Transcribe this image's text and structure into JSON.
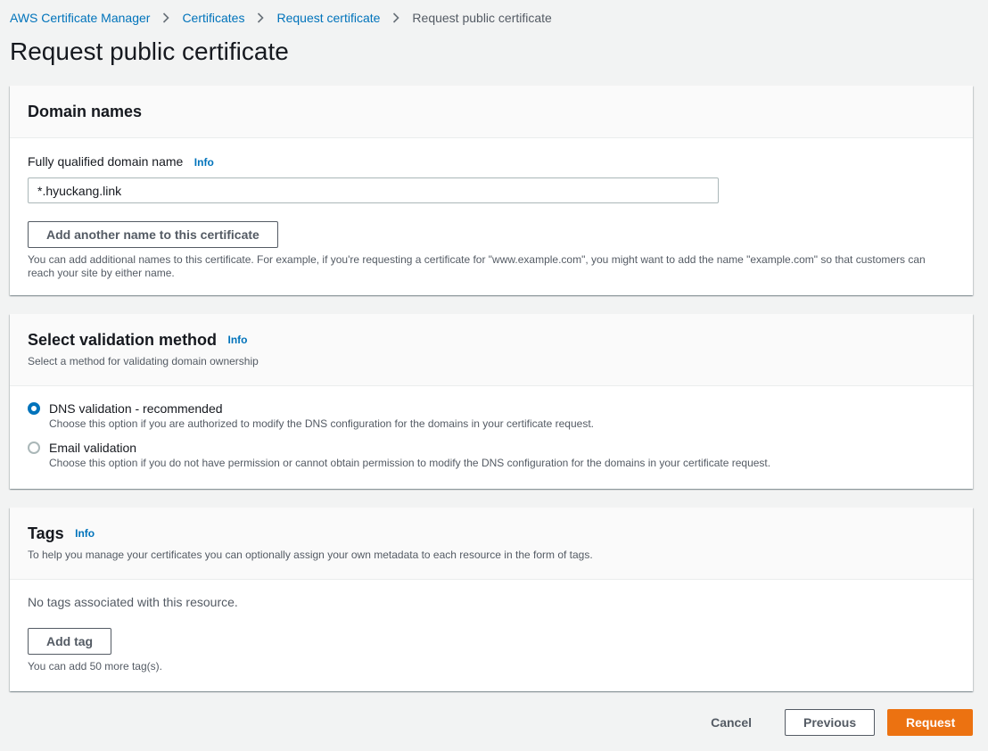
{
  "breadcrumb": {
    "items": [
      "AWS Certificate Manager",
      "Certificates",
      "Request certificate"
    ],
    "current": "Request public certificate"
  },
  "page_title": "Request public certificate",
  "domain_panel": {
    "title": "Domain names",
    "field_label": "Fully qualified domain name",
    "info": "Info",
    "domain_value": "*.hyuckang.link",
    "add_name_button": "Add another name to this certificate",
    "hint": "You can add additional names to this certificate. For example, if you're requesting a certificate for \"www.example.com\", you might want to add the name \"example.com\" so that customers can reach your site by either name."
  },
  "validation_panel": {
    "title": "Select validation method",
    "info": "Info",
    "description": "Select a method for validating domain ownership",
    "options": [
      {
        "label": "DNS validation - recommended",
        "description": "Choose this option if you are authorized to modify the DNS configuration for the domains in your certificate request.",
        "selected": true
      },
      {
        "label": "Email validation",
        "description": "Choose this option if you do not have permission or cannot obtain permission to modify the DNS configuration for the domains in your certificate request.",
        "selected": false
      }
    ]
  },
  "tags_panel": {
    "title": "Tags",
    "info": "Info",
    "description": "To help you manage your certificates you can optionally assign your own metadata to each resource in the form of tags.",
    "empty_text": "No tags associated with this resource.",
    "add_tag_button": "Add tag",
    "limit_hint": "You can add 50 more tag(s)."
  },
  "actions": {
    "cancel": "Cancel",
    "previous": "Previous",
    "request": "Request"
  },
  "colors": {
    "link": "#0073bb",
    "primary": "#ec7211",
    "background": "#f2f3f3"
  }
}
